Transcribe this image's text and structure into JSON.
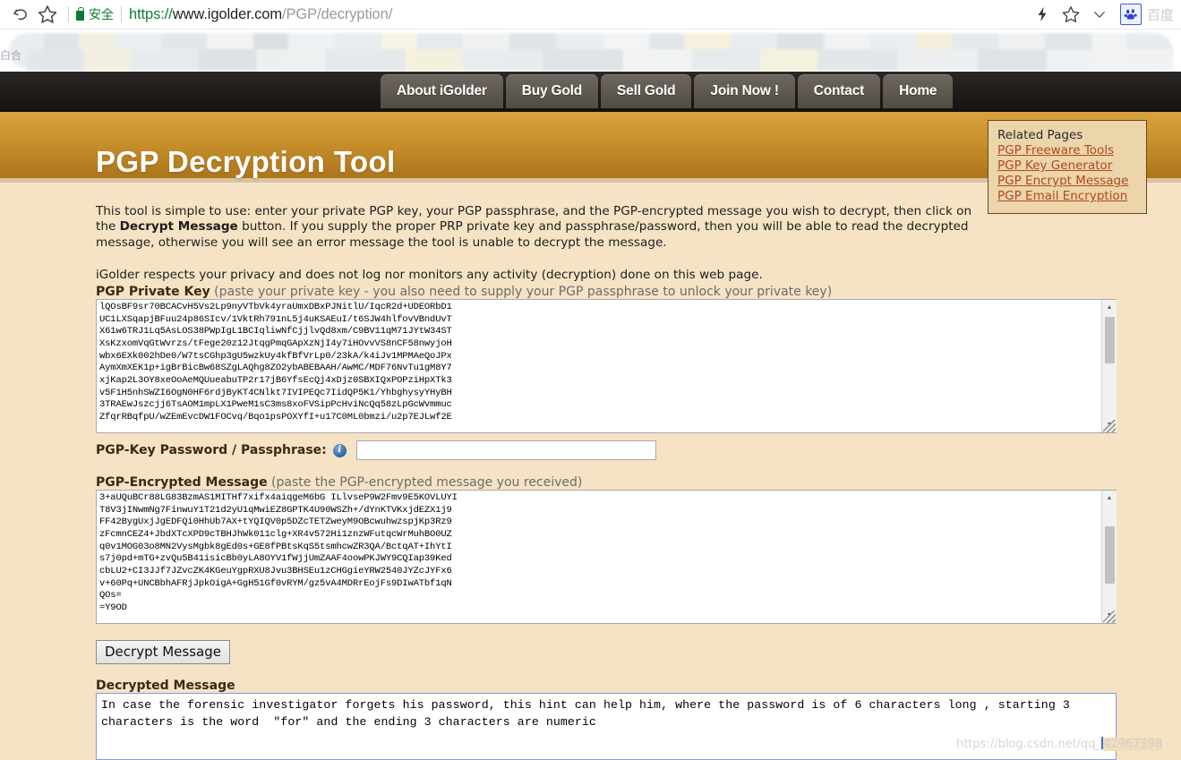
{
  "browser": {
    "back_icon": "back-arrow-icon",
    "bookmark_icon": "star-icon",
    "secure_label": "安全",
    "url": {
      "scheme": "https://",
      "host": "www.igolder.com",
      "path": "/PGP/decryption/"
    },
    "lightning_icon": "lightning-icon",
    "star_icon": "star-icon",
    "chevron_icon": "chevron-down-icon",
    "baidu_icon": "baidu-paw-icon",
    "baidu_label": "百度"
  },
  "site_nav": {
    "items": [
      {
        "label": "About iGolder"
      },
      {
        "label": "Buy Gold"
      },
      {
        "label": "Sell Gold"
      },
      {
        "label": "Join Now !"
      },
      {
        "label": "Contact"
      },
      {
        "label": "Home"
      }
    ]
  },
  "header": {
    "title": "PGP Decryption Tool"
  },
  "related_pages": {
    "title": "Related Pages",
    "links": [
      {
        "label": "PGP Freeware Tools"
      },
      {
        "label": "PGP Key Generator"
      },
      {
        "label": "PGP Encrypt Message"
      },
      {
        "label": "PGP Email Encryption"
      }
    ]
  },
  "intro": {
    "part1": "This tool is simple to use: enter your private PGP key, your PGP passphrase, and the PGP-encrypted message you wish to decrypt, then click on the ",
    "bold": "Decrypt Message",
    "part2": " button.  If you supply the proper PRP private key and passphrase/password, then you will be able to read the decrypted message, otherwise you will see an error message the tool is unable to decrypt the message.",
    "privacy": "iGolder respects your privacy and does not log nor monitors any activity (decryption) done on this web page."
  },
  "private_key": {
    "label_strong": "PGP Private Key",
    "label_hint": " (paste your private key - you also need to supply your PGP passphrase to unlock your private key)",
    "value": "lQOsBF9sr70BCACvH5Vs2Lp9nyVTbVk4yraUmxDBxPJNitlU/IqcR2d+UDEORbD1\nUC1LXSqapjBFuu24p86SIcv/1VktRh791nL5j4uKSAEuI/t6SJW4hlfovVBndUvT\nX61w6TRJ1Lq5AsLOS38PWpIgL1BCIqliwNfCjjlvQd8xm/C9BV11qM71JYtW34ST\nXsKzxomVqGtWvrzs/tFege20z12JtqgPmqGApXzNjI4y7iHOvvVS8nCF58nwyjoH\nwbx6EXk002hDe0/W7tsCGhp3gU5wzkUy4kfBfVrLp0/23kA/k4iJv1MPMAeQoJPx\nAymXmXEK1p+igBrBicBw68SZgLAQhg8ZO2ybABEBAAH/AwMC/MDF76NvTu1gM8Y7\nxjKap2L3OY8xeOoAeMQUueabuTP2r17jB6YfsEcQj4xDjz0SBXIQxPOPziHpXTk3\nv5F1H5nhSWZI6OgN0HF6rdjByKT4CNlkt7IVIPEQc7IidQP5K1/YhbghysyYHyBH\n3TRAEwJszcjj6TsAOM1mpLX1PweM1sC3ms8xoFVSipPcHviNcQq58zLpGcWvmmuc\nZfqrRBqfpU/wZEmEvcDW1FOCvq/Bqo1psPOXYfI+u17C0ML0bmzi/u2p7EJLwf2E"
  },
  "passphrase": {
    "label": "PGP-Key Password / Passphrase:",
    "info_icon": "info-icon",
    "value": "",
    "placeholder": ""
  },
  "encrypted_message": {
    "label_strong": "PGP-Encrypted Message",
    "label_hint": " (paste the PGP-encrypted message you received)",
    "value": "3+aUQuBCr88LG83BzmAS1MITHf7xifx4aiqgeM6bG ILlvseP9W2Fmv9E5KOVLUYI\nT8V3jINwmNg7FinwuY1T21d2yU1qMwiEZ8GPTK4U90WSZh+/dYnKTVKxjdEZX1j9\nFF42BygUxjJgEDFQi0HhUb7AX+tYQIQV0p5DZcTETZweyM9OBcwuhwzspjKp3Rz9\nzFcmnCEZ4+JbdXTcXPD9cTBHJhWk011clg+XR4v572Hi1znzWFutqcWrMuhBO0UZ\nq0v1MOG03o8MN2VysMgbk8gEd0s+GE8fPBtsKqS5tsmhcwZR3QA/BctqAT+IhYtI\ns7j0pd+mTG+zvQu5B41isicBb0yLA8OYV1fWjjUmZAAF4oowPKJWY9CQIap39Ked\ncbLU2+CI3JJf7JZvcZK4KGeuYgpRXU8Jvu3BHSEu1zCHGgieYRW2540JYZcJYFx6\nv+60Pq+UNCBbhAFRjJpkOigA+GgH51Gf0vRYM/gz5vA4MDRrEojFs9DIwATbf1qN\nQOs=\n=Y9OD"
  },
  "decrypt_button": {
    "label": "Decrypt Message"
  },
  "decrypted": {
    "label": "Decrypted Message",
    "value": "In case the forensic investigator forgets his password, this hint can help him, where the password is of 6 characters long , starting 3 characters is the word  \"for\" and the ending 3 characters are numeric"
  },
  "watermark": {
    "prefix": "https://blog.csdn.net/qq_",
    "selected": "42967398"
  },
  "colors": {
    "gold": "#c68f2b",
    "page_bg": "#f6e3c5",
    "nav_bg": "#1d1b18",
    "link": "#b04a1e",
    "secure_green": "#0a7d32"
  }
}
